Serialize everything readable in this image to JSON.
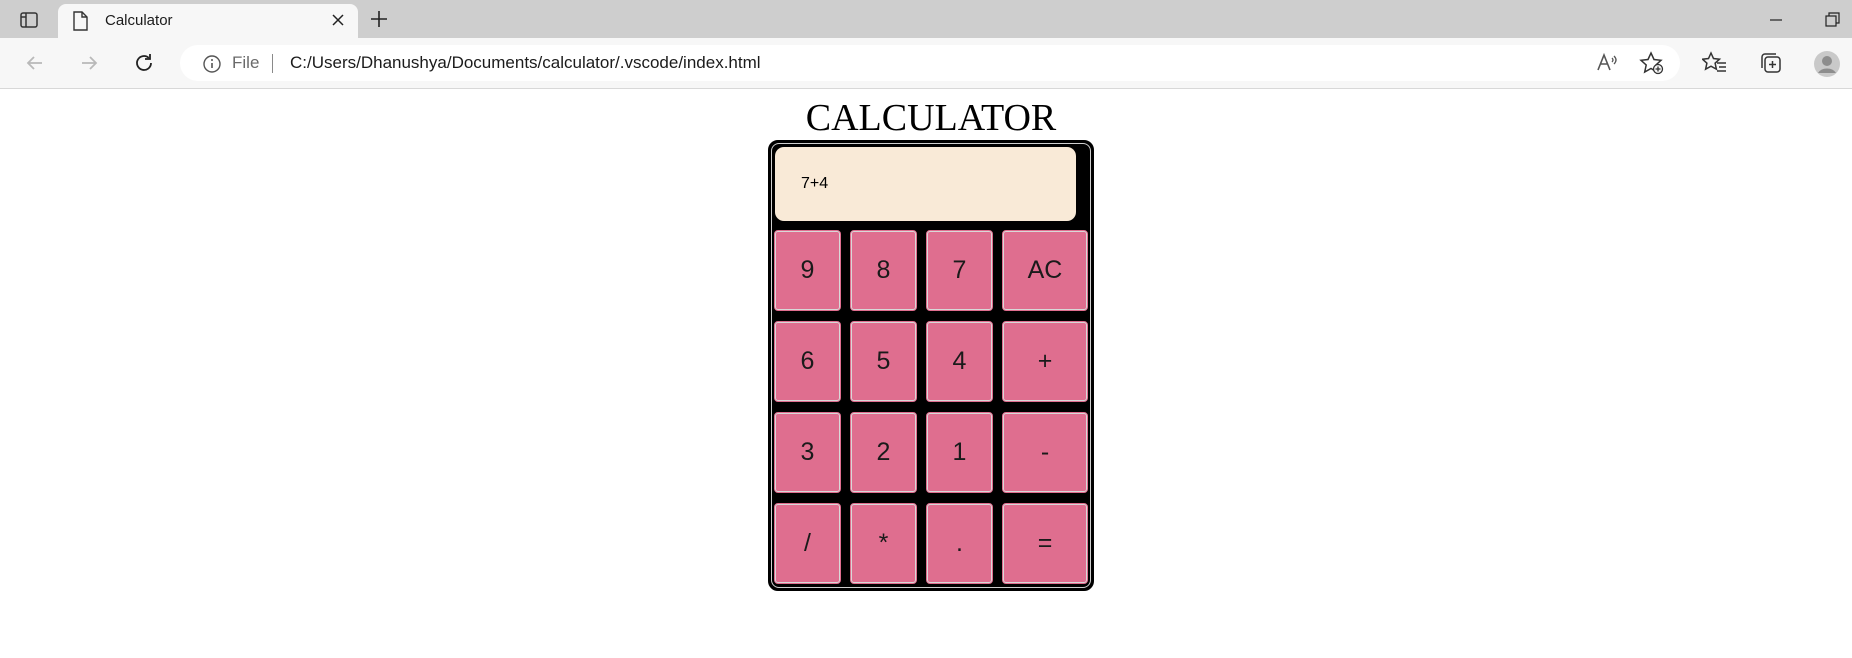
{
  "browser": {
    "tab_title": "Calculator",
    "address_prefix": "File",
    "url": "C:/Users/Dhanushya/Documents/calculator/.vscode/index.html"
  },
  "page": {
    "title": "CALCULATOR"
  },
  "calculator": {
    "display_value": "7+4",
    "keys": [
      "9",
      "8",
      "7",
      "AC",
      "6",
      "5",
      "4",
      "+",
      "3",
      "2",
      "1",
      "-",
      "/",
      "*",
      ".",
      "="
    ]
  },
  "colors": {
    "key_background": "#df6e8f",
    "display_background": "#f9ead7",
    "calculator_body": "#000000"
  }
}
